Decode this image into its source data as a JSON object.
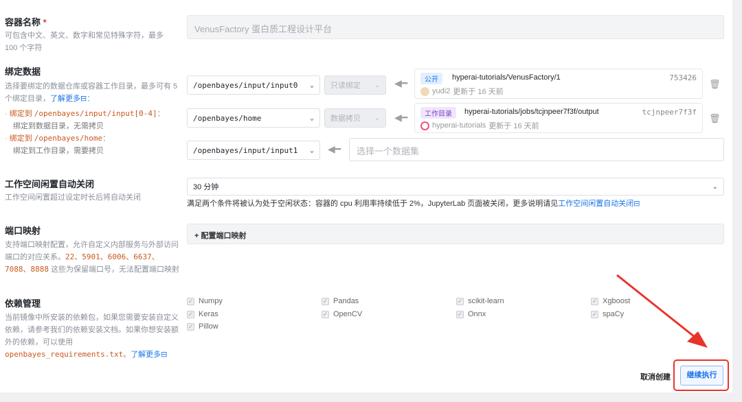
{
  "name": {
    "label": "容器名称",
    "required": "*",
    "desc": "可包含中文、英文、数字和常见特殊字符，最多 100 个字符",
    "value": "VenusFactory 蛋白质工程设计平台"
  },
  "binding": {
    "label": "绑定数据",
    "desc": "选择要绑定的数据仓库或容器工作目录，最多可有 5 个绑定目录，",
    "learn_more": "了解更多",
    "colon": "：",
    "rule1_prefix": "绑定到",
    "rule1_path": "/openbayes/input/input[0-4]",
    "rule1_desc": "绑定到数据目录，无需拷贝",
    "rule2_prefix": "绑定到",
    "rule2_path": "/openbayes/home",
    "rule2_desc": "绑定到工作目录，需要拷贝",
    "rows": [
      {
        "path": "/openbayes/input/input0",
        "mode": "只读绑定",
        "tag": "公开",
        "name": "hyperai-tutorials/VenusFactory/1",
        "id": "753426",
        "user": "yudi2",
        "updated": "更新于 16 天前"
      },
      {
        "path": "/openbayes/home",
        "mode": "数据拷贝",
        "tag": "工作目录",
        "name": "hyperai-tutorials/jobs/tcjnpeer7f3f/output",
        "id": "tcjnpeer7f3f",
        "user": "hyperai-tutorials",
        "updated": "更新于 16 天前"
      },
      {
        "path": "/openbayes/input/input1",
        "placeholder": "选择一个数据集"
      }
    ]
  },
  "idle": {
    "label": "工作空间闲置自动关闭",
    "desc": "工作空间闲置超过设定时长后将自动关闭",
    "value": "30 分钟",
    "note": "满足两个条件将被认为处于空闲状态：容器的 cpu 利用率持续低于 2%，JupyterLab 页面被关闭，更多说明请见",
    "note_link": "工作空间闲置自动关闭"
  },
  "port": {
    "label": "端口映射",
    "desc1": "支持端口映射配置，允许自定义内部服务与外部访问端口的对应关系。",
    "ports1": "22、5901、6006、6637、",
    "ports2": "7088、8888",
    "desc2": " 这些为保留端口号，无法配置端口映射",
    "button": "+ 配置端口映射"
  },
  "deps": {
    "label": "依赖管理",
    "desc": "当前镜像中所安装的依赖包，如果您需要安装自定义依赖，请参考我们的依赖安装文档。如果你想安装额外的依赖，可以使用",
    "file": "openbayes_requirements.txt",
    "sep": "。",
    "learn_more": "了解更多",
    "items": [
      "Numpy",
      "Pandas",
      "scikit-learn",
      "Xgboost",
      "Keras",
      "OpenCV",
      "Onnx",
      "spaCy",
      "Pillow"
    ]
  },
  "actions": {
    "cancel": "取消创建",
    "continue": "继续执行"
  },
  "colors": {
    "accent": "#1a73e8",
    "code": "#c8591e",
    "annotation": "#e8332a"
  }
}
